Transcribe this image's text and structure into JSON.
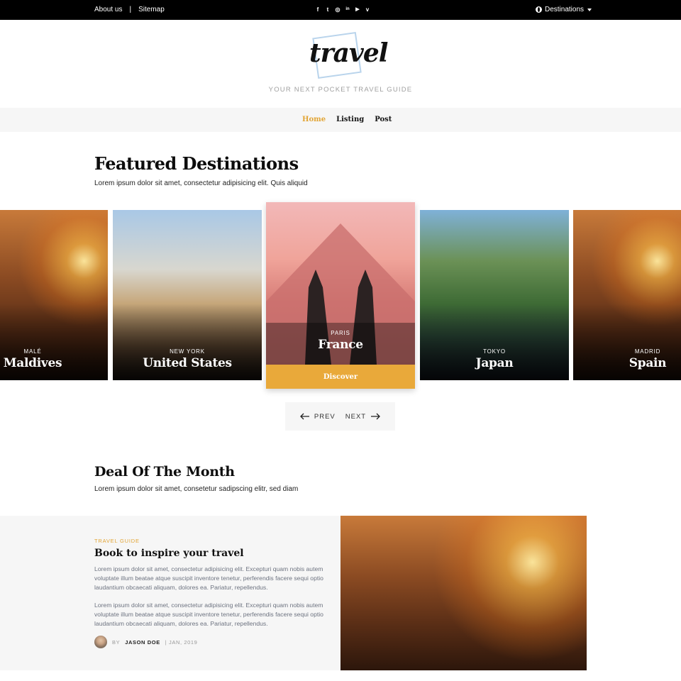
{
  "topbar": {
    "about": "About us",
    "separator": "|",
    "sitemap": "Sitemap",
    "social": [
      {
        "icon": "facebook-icon",
        "glyph": "f"
      },
      {
        "icon": "twitter-icon",
        "glyph": "t"
      },
      {
        "icon": "instagram-icon",
        "glyph": "◎"
      },
      {
        "icon": "linkedin-icon",
        "glyph": "in"
      },
      {
        "icon": "youtube-icon",
        "glyph": "▶"
      },
      {
        "icon": "vimeo-icon",
        "glyph": "v"
      }
    ],
    "destinations": "Destinations"
  },
  "logo": {
    "word": "travel",
    "tagline": "YOUR NEXT POCKET TRAVEL GUIDE"
  },
  "nav": {
    "items": [
      "Home",
      "Listing",
      "Post"
    ],
    "active": "Home"
  },
  "featured": {
    "title": "Featured Destinations",
    "subtitle": "Lorem ipsum dolor sit amet, consectetur adipisicing elit. Quis aliquid",
    "cards": [
      {
        "city": "MALÉ",
        "country": "Maldives"
      },
      {
        "city": "NEW YORK",
        "country": "United States"
      },
      {
        "city": "PARIS",
        "country": "France",
        "cta": "Discover"
      },
      {
        "city": "TOKYO",
        "country": "Japan"
      },
      {
        "city": "MADRID",
        "country": "Spain"
      }
    ],
    "prev": "PREV",
    "next": "NEXT"
  },
  "deal": {
    "title": "Deal Of The Month",
    "subtitle": "Lorem ipsum dolor sit amet, consetetur sadipscing elitr, sed diam",
    "tag": "TRAVEL GUIDE",
    "headline": "Book to inspire your travel",
    "para1": "Lorem ipsum dolor sit amet, consectetur adipisicing elit. Excepturi quam nobis autem voluptate illum beatae atque suscipit inventore tenetur, perferendis facere sequi optio laudantium obcaecati aliquam, dolores ea. Pariatur, repellendus.",
    "para2": "Lorem ipsum dolor sit amet, consectetur adipisicing elit. Excepturi quam nobis autem voluptate illum beatae atque suscipit inventore tenetur, perferendis facere sequi optio laudantium obcaecati aliquam, dolores ea. Pariatur, repellendus.",
    "by": "BY",
    "author": "JASON DOE",
    "date": "| JAN, 2019"
  },
  "colors": {
    "accent": "#e9a93a",
    "topbar": "#000000",
    "panel": "#f6f6f6"
  }
}
